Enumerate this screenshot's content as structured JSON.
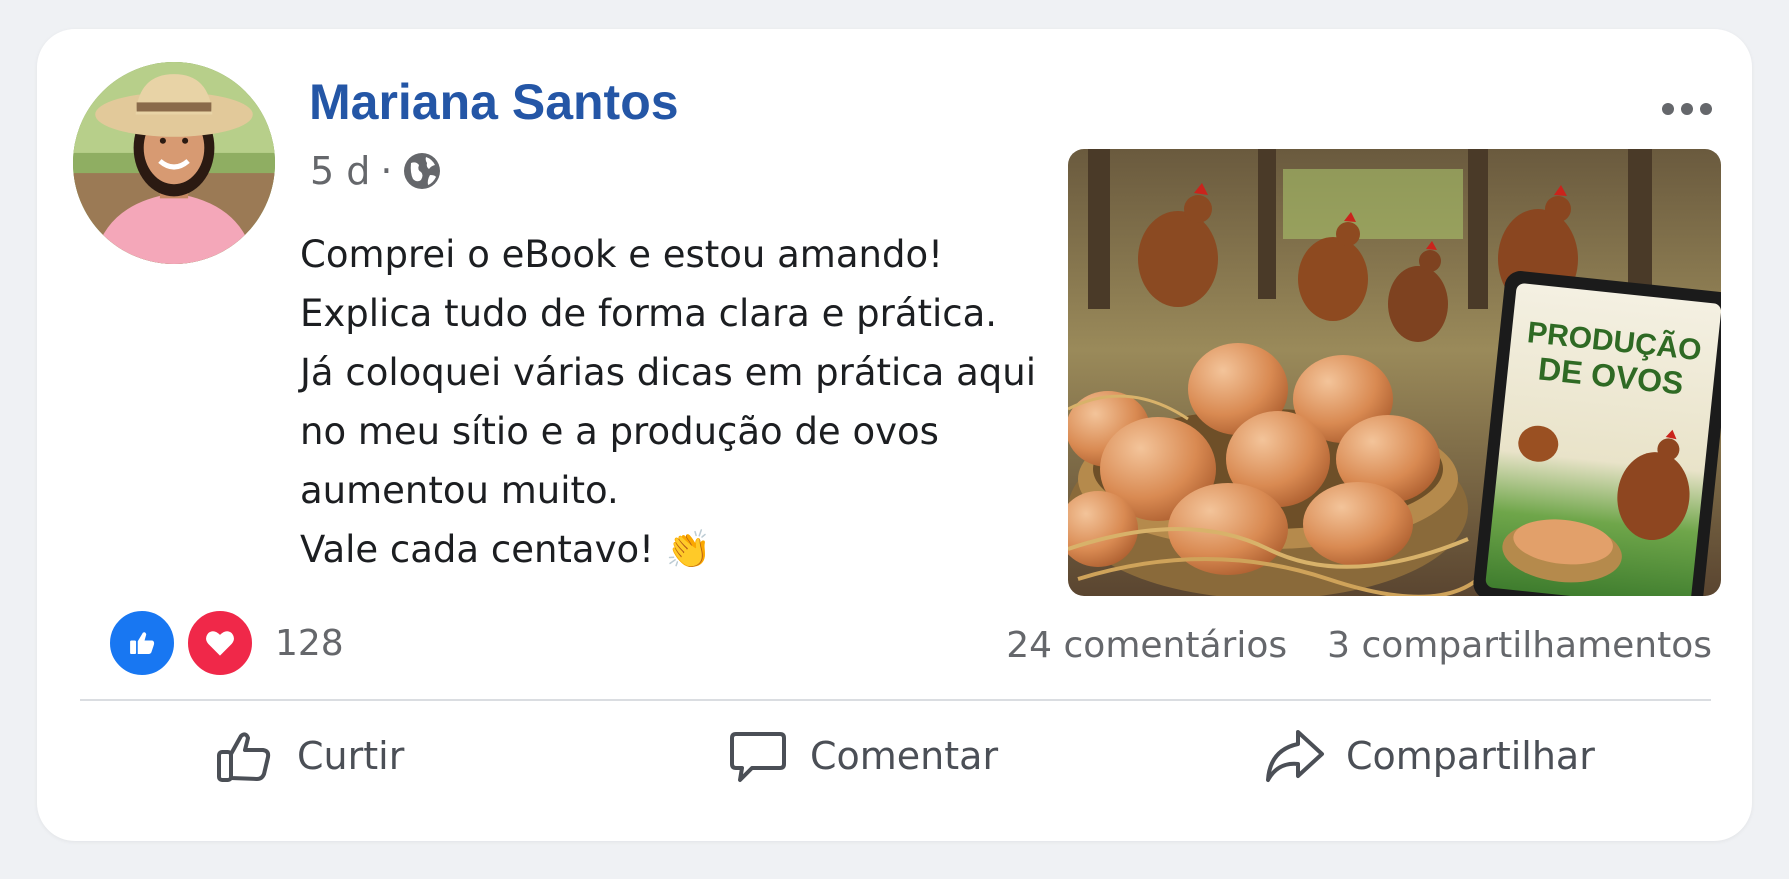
{
  "post": {
    "author": "Mariana Santos",
    "time": "5 d",
    "separator": "·",
    "visibility_icon": "globe-icon",
    "text_lines": [
      "Comprei o eBook e estou amando!",
      "Explica tudo de forma clara e prática.",
      "Já coloquei várias dicas em prática aqui",
      "no meu sítio e a produção de ovos",
      "aumentou muito.",
      "Vale cada centavo! 👏"
    ],
    "image": {
      "ebook_title_line1": "PRODUÇÃO",
      "ebook_title_line2": "DE OVOS"
    }
  },
  "stats": {
    "reaction_icons": [
      "like-icon",
      "heart-icon"
    ],
    "reaction_count": "128",
    "comments": "24 comentários",
    "shares": "3 compartilhamentos"
  },
  "actions": {
    "like_label": "Curtir",
    "comment_label": "Comentar",
    "share_label": "Compartilhar"
  },
  "colors": {
    "author_name": "#2456a6",
    "like_badge": "#1877f2",
    "love_badge": "#f02849",
    "background": "#eff1f4"
  }
}
